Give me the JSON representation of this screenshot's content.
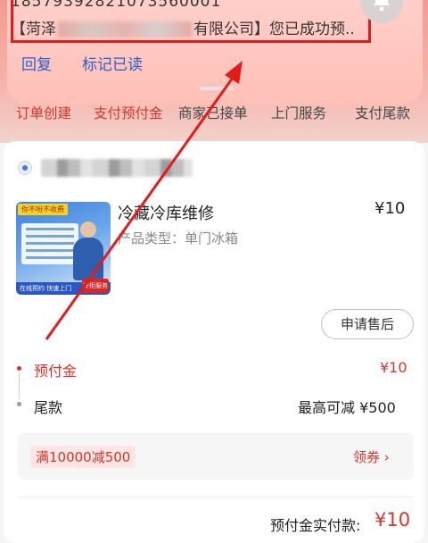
{
  "notification": {
    "line1": "18579392821073560001",
    "line2_prefix": "【菏泽",
    "line2_suffix": "有限公司】您已成功预..",
    "reply_label": "回复",
    "mark_read_label": "标记已读"
  },
  "steps": [
    {
      "label": "订单创建",
      "state": "active"
    },
    {
      "label": "支付预付金",
      "state": "active"
    },
    {
      "label": "商家已接单",
      "state": "inactive"
    },
    {
      "label": "上门服务",
      "state": "inactive"
    },
    {
      "label": "支付尾款",
      "state": "inactive"
    }
  ],
  "product": {
    "thumb_tag": "你不吩不收费",
    "thumb_bar": "在线预约 快速上门",
    "thumb_badge": "冷柜服务",
    "name": "冷藏冷库维修",
    "price": "¥10",
    "type": "产品类型：单门冰箱",
    "after_sales": "申请售后"
  },
  "payment": {
    "deposit_label": "预付金",
    "deposit_value": "¥10",
    "balance_label": "尾款",
    "balance_value": "最高可减 ¥500",
    "coupon_tag": "满10000减500",
    "coupon_link": "领券",
    "pay_label": "预付金实付款:",
    "pay_value": "¥10"
  },
  "colors": {
    "accent": "#d9342b",
    "link": "#2c60c8",
    "highlight": "#e21b1b"
  }
}
